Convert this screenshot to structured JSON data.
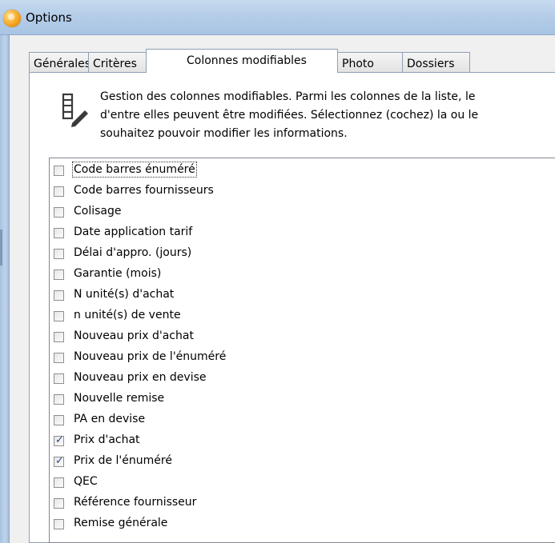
{
  "window": {
    "title": "Options",
    "app_icon": "app-orb-icon"
  },
  "tabs": [
    {
      "label": "Générales",
      "active": false
    },
    {
      "label": "Critères",
      "active": false
    },
    {
      "label": "Colonnes modifiables",
      "active": true
    },
    {
      "label": "Photo",
      "active": false
    },
    {
      "label": "Dossiers",
      "active": false
    }
  ],
  "description": {
    "icon": "edit-column-icon",
    "lines": [
      "Gestion des colonnes modifiables. Parmi les colonnes de la liste, le",
      "d'entre elles peuvent être modifiées. Sélectionnez (cochez) la ou le",
      "souhaitez pouvoir modifier les informations."
    ]
  },
  "columns": [
    {
      "label": "Code barres énuméré",
      "checked": false,
      "focused": true
    },
    {
      "label": "Code barres fournisseurs",
      "checked": false
    },
    {
      "label": "Colisage",
      "checked": false
    },
    {
      "label": "Date application tarif",
      "checked": false
    },
    {
      "label": "Délai d'appro. (jours)",
      "checked": false
    },
    {
      "label": "Garantie (mois)",
      "checked": false
    },
    {
      "label": "N unité(s) d'achat",
      "checked": false
    },
    {
      "label": "n unité(s) de vente",
      "checked": false
    },
    {
      "label": "Nouveau prix d'achat",
      "checked": false
    },
    {
      "label": "Nouveau prix de l'énuméré",
      "checked": false
    },
    {
      "label": "Nouveau prix en devise",
      "checked": false
    },
    {
      "label": "Nouvelle remise",
      "checked": false
    },
    {
      "label": "PA en devise",
      "checked": false
    },
    {
      "label": "Prix d'achat",
      "checked": true
    },
    {
      "label": "Prix de l'énuméré",
      "checked": true
    },
    {
      "label": "QEC",
      "checked": false
    },
    {
      "label": "Référence fournisseur",
      "checked": false
    },
    {
      "label": "Remise générale",
      "checked": false
    }
  ],
  "colors": {
    "titlebar": "#b4cde8",
    "check_mark": "#2c4a86",
    "tab_border": "#8e9fb5"
  }
}
